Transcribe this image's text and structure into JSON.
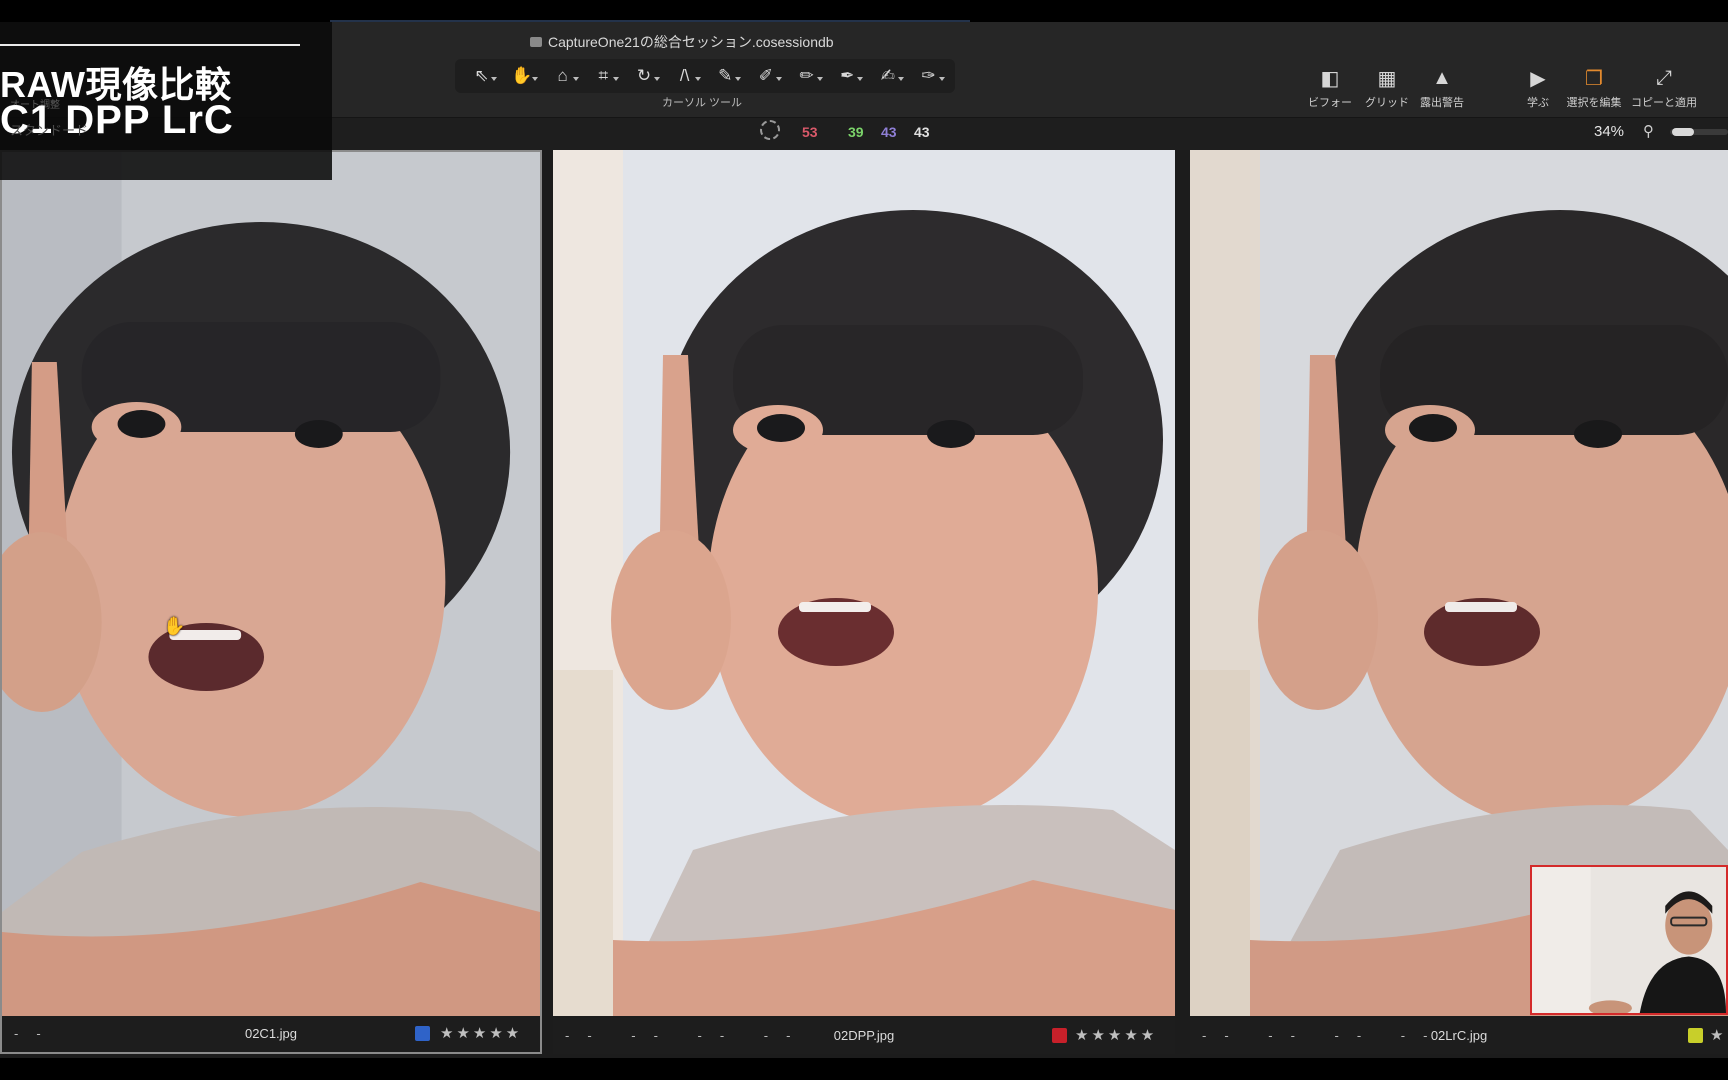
{
  "window": {
    "document_title": "CaptureOne21の総合セッション.cosessiondb"
  },
  "overlay": {
    "heading": "RAW現像比較",
    "subheading": "C1  DPP  LrC",
    "ghost_label_top": "オート調整",
    "ghost_label_bottom": "スタンドード"
  },
  "toolbar": {
    "cursor_tools_label": "カーソル ツール",
    "tools": [
      {
        "name": "select-tool-icon",
        "glyph": "⇖",
        "active": false
      },
      {
        "name": "pan-hand-tool-icon",
        "glyph": "✋",
        "active": true
      },
      {
        "name": "straighten-tool-icon",
        "glyph": "⌂",
        "active": false
      },
      {
        "name": "crop-tool-icon",
        "glyph": "⌗",
        "active": false
      },
      {
        "name": "rotate-tool-icon",
        "glyph": "↻",
        "active": false
      },
      {
        "name": "keystone-tool-icon",
        "glyph": "/\\",
        "active": false
      },
      {
        "name": "draw-mask-tool-icon",
        "glyph": "✎",
        "active": false
      },
      {
        "name": "erase-mask-tool-icon",
        "glyph": "✐",
        "active": false
      },
      {
        "name": "gradient-mask-tool-icon",
        "glyph": "✏",
        "active": false
      },
      {
        "name": "picker-tool-icon",
        "glyph": "✒",
        "active": false
      },
      {
        "name": "healing-tool-icon",
        "glyph": "✍",
        "active": false
      },
      {
        "name": "annotate-tool-icon",
        "glyph": "✑",
        "active": false
      }
    ],
    "right_tools": [
      {
        "name": "before-after-button",
        "icon": "before-after-icon",
        "glyph": "◧",
        "label": "ビフォー"
      },
      {
        "name": "grid-button",
        "icon": "grid-icon",
        "glyph": "▦",
        "label": "グリッド"
      },
      {
        "name": "exposure-warning-button",
        "icon": "warning-icon",
        "glyph": "▲",
        "label": "露出警告"
      },
      {
        "name": "learn-button",
        "icon": "play-icon",
        "glyph": "▶",
        "label": "学ぶ"
      },
      {
        "name": "edit-selected-button",
        "icon": "stack-icon",
        "glyph": "❐",
        "label": "選択を編集"
      },
      {
        "name": "copy-apply-button",
        "icon": "expand-arrow-icon",
        "glyph": "⤢",
        "label": "コピーと適用"
      }
    ]
  },
  "status": {
    "counts": [
      {
        "value": "53",
        "color": "#d9596a"
      },
      {
        "value": "39",
        "color": "#7bd36a"
      },
      {
        "value": "43",
        "color": "#8f7fd6"
      },
      {
        "value": "43",
        "color": "#e0e0e0"
      }
    ],
    "zoom": "34%"
  },
  "panels": [
    {
      "filename": "02C1.jpg",
      "dashes": "--",
      "label_color": "#2f63c8",
      "stars": "★★★★★",
      "selected": true
    },
    {
      "filename": "02DPP.jpg",
      "dashes": "-- -- -- --",
      "label_color": "#c8202a",
      "stars": "★★★★★",
      "selected": false
    },
    {
      "filename": "02LrC.jpg",
      "dashes": "-- -- -- --",
      "label_color": "#c8cf2a",
      "stars": "★",
      "selected": false
    }
  ]
}
